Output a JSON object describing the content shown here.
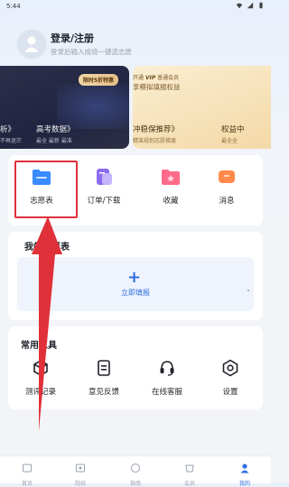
{
  "status_bar": {
    "time": "5:44"
  },
  "profile": {
    "title": "登录/注册",
    "subtitle": "登录后输入成绩一键选志愿"
  },
  "banner_left": {
    "tag": "限时5折特惠",
    "line1_prefix": "析》",
    "line1_main": "高考数据》",
    "line2_prefix": "不再迷茫",
    "line2_main": "最全 最新 最准"
  },
  "banner_right": {
    "line1_prefix": "开通",
    "line1_vip": "VIP",
    "line1_suffix": "普通会员",
    "line2": "享模拟填报权益",
    "line3_a": "冲稳保推荐》",
    "line3_b": "权益中",
    "line4_a": "精准规划志愿梯度",
    "line4_b": "最全全"
  },
  "quick_actions": [
    {
      "label": "志愿表",
      "icon": "folder-icon",
      "color": "#3a8bff"
    },
    {
      "label": "订单/下载",
      "icon": "order-icon",
      "color": "#8b6cf0"
    },
    {
      "label": "收藏",
      "icon": "star-folder-icon",
      "color": "#ff6a88"
    },
    {
      "label": "消息",
      "icon": "message-icon",
      "color": "#ff8a4a"
    }
  ],
  "wish_list": {
    "title": "我的志愿表",
    "plus": "+",
    "fill_label": "立即填报"
  },
  "tools": {
    "title": "常用工具",
    "items": [
      {
        "label": "测评记录",
        "icon": "cube-icon"
      },
      {
        "label": "意见反馈",
        "icon": "feedback-icon"
      },
      {
        "label": "在线客服",
        "icon": "headset-icon"
      },
      {
        "label": "设置",
        "icon": "settings-icon"
      }
    ]
  },
  "tabbar": {
    "items": [
      {
        "label": "首页",
        "icon": "home-icon"
      },
      {
        "label": "院校",
        "icon": "school-icon"
      },
      {
        "label": "指南",
        "icon": "compass-icon"
      },
      {
        "label": "会员",
        "icon": "vip-icon"
      },
      {
        "label": "我的",
        "icon": "person-icon"
      }
    ],
    "active": "我的"
  },
  "colors": {
    "accent": "#2f6fe0",
    "highlight": "#e0303a"
  }
}
